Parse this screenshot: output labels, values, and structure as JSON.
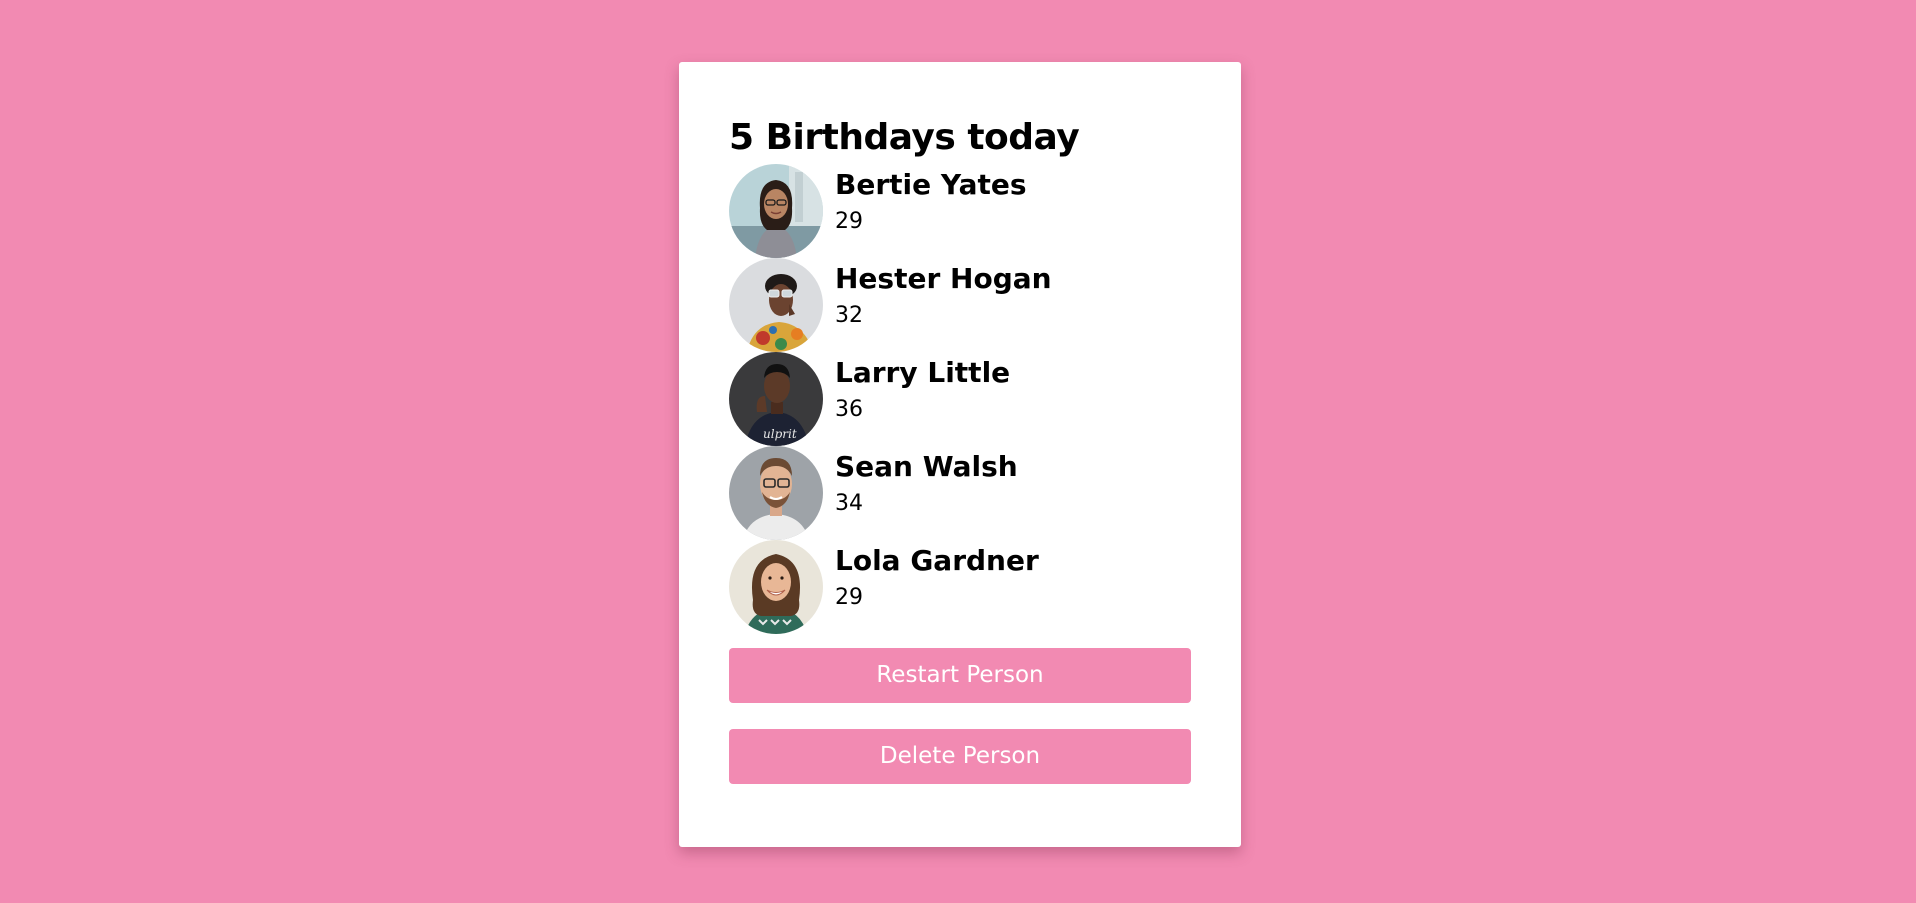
{
  "title": "5 Birthdays today",
  "people": [
    {
      "name": "Bertie Yates",
      "age": "29"
    },
    {
      "name": "Hester Hogan",
      "age": "32"
    },
    {
      "name": "Larry Little",
      "age": "36"
    },
    {
      "name": "Sean Walsh",
      "age": "34"
    },
    {
      "name": "Lola Gardner",
      "age": "29"
    }
  ],
  "buttons": {
    "restart_label": "Restart Person",
    "delete_label": "Delete Person"
  },
  "colors": {
    "background": "#f28ab2",
    "button": "#f28ab2",
    "card": "#ffffff"
  }
}
